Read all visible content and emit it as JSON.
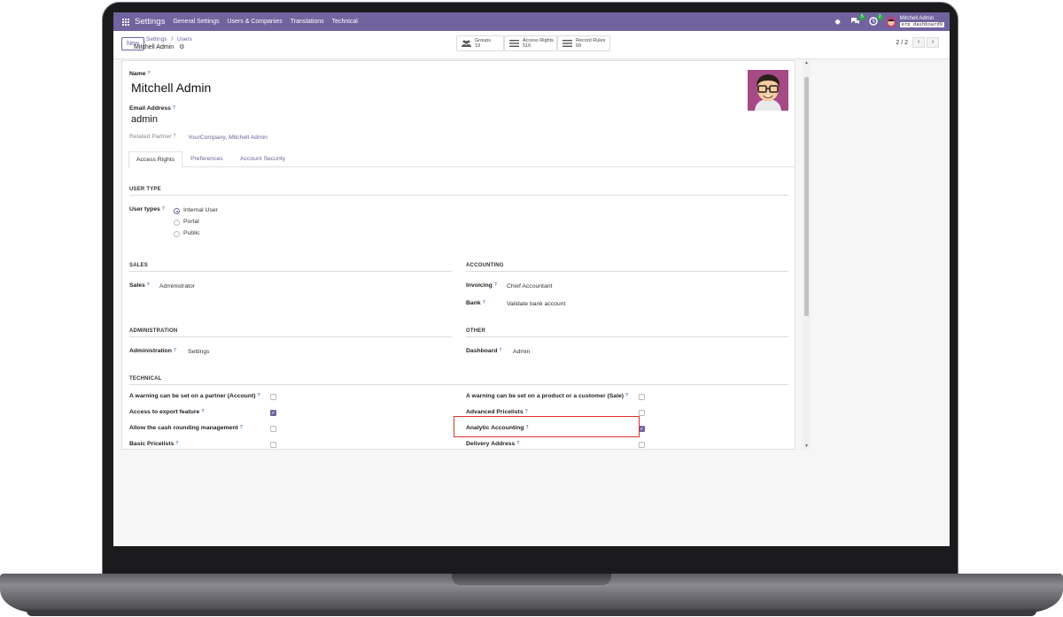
{
  "navbar": {
    "brand": "Settings",
    "menu": [
      "General Settings",
      "Users & Companies",
      "Translations",
      "Technical"
    ],
    "chat_badge": "5",
    "activity_badge": "2",
    "user_name": "Mitchell Admin",
    "db_name": "erp_dashboard9"
  },
  "control": {
    "new_label": "New",
    "breadcrumb_parent": "Settings",
    "breadcrumb_sep": "/",
    "breadcrumb_users": "Users",
    "record_title": "Mitchell Admin",
    "smart_buttons": [
      {
        "label": "Groups",
        "count": "19",
        "icon": "users-icon"
      },
      {
        "label": "Access Rights",
        "count": "516",
        "icon": "list-icon"
      },
      {
        "label": "Record Rules",
        "count": "69",
        "icon": "list-icon"
      }
    ],
    "pager": "2 / 2"
  },
  "form": {
    "name_label": "Name",
    "name_value": "Mitchell Admin",
    "email_label": "Email Address",
    "email_value": "admin",
    "partner_label": "Related Partner",
    "partner_value": "YourCompany, Mitchell Admin",
    "help_mark": "?",
    "tabs": [
      "Access Rights",
      "Preferences",
      "Account Security"
    ],
    "user_type": {
      "section": "USER TYPE",
      "label": "User types",
      "options": [
        "Internal User",
        "Portal",
        "Public"
      ],
      "selected": "Internal User"
    },
    "sales": {
      "section": "SALES",
      "label": "Sales",
      "value": "Administrator"
    },
    "accounting": {
      "section": "ACCOUNTING",
      "invoicing_label": "Invoicing",
      "invoicing_value": "Chief Accountant",
      "bank_label": "Bank",
      "bank_value": "Validate bank account"
    },
    "administration": {
      "section": "ADMINISTRATION",
      "label": "Administration",
      "value": "Settings"
    },
    "other": {
      "section": "OTHER",
      "label": "Dashboard",
      "value": "Admin"
    },
    "technical": {
      "section": "TECHNICAL",
      "left": [
        {
          "label": "A warning can be set on a partner (Account)",
          "checked": false
        },
        {
          "label": "Access to export feature",
          "checked": true
        },
        {
          "label": "Allow the cash rounding management",
          "checked": false
        },
        {
          "label": "Basic Pricelists",
          "checked": false
        }
      ],
      "right": [
        {
          "label": "A warning can be set on a product or a customer (Sale)",
          "checked": false
        },
        {
          "label": "Advanced Pricelists",
          "checked": false
        },
        {
          "label": "Analytic Accounting",
          "checked": true
        },
        {
          "label": "Delivery Address",
          "checked": false
        }
      ]
    }
  },
  "colors": {
    "brand": "#71639e",
    "highlight": "#e0312b"
  }
}
